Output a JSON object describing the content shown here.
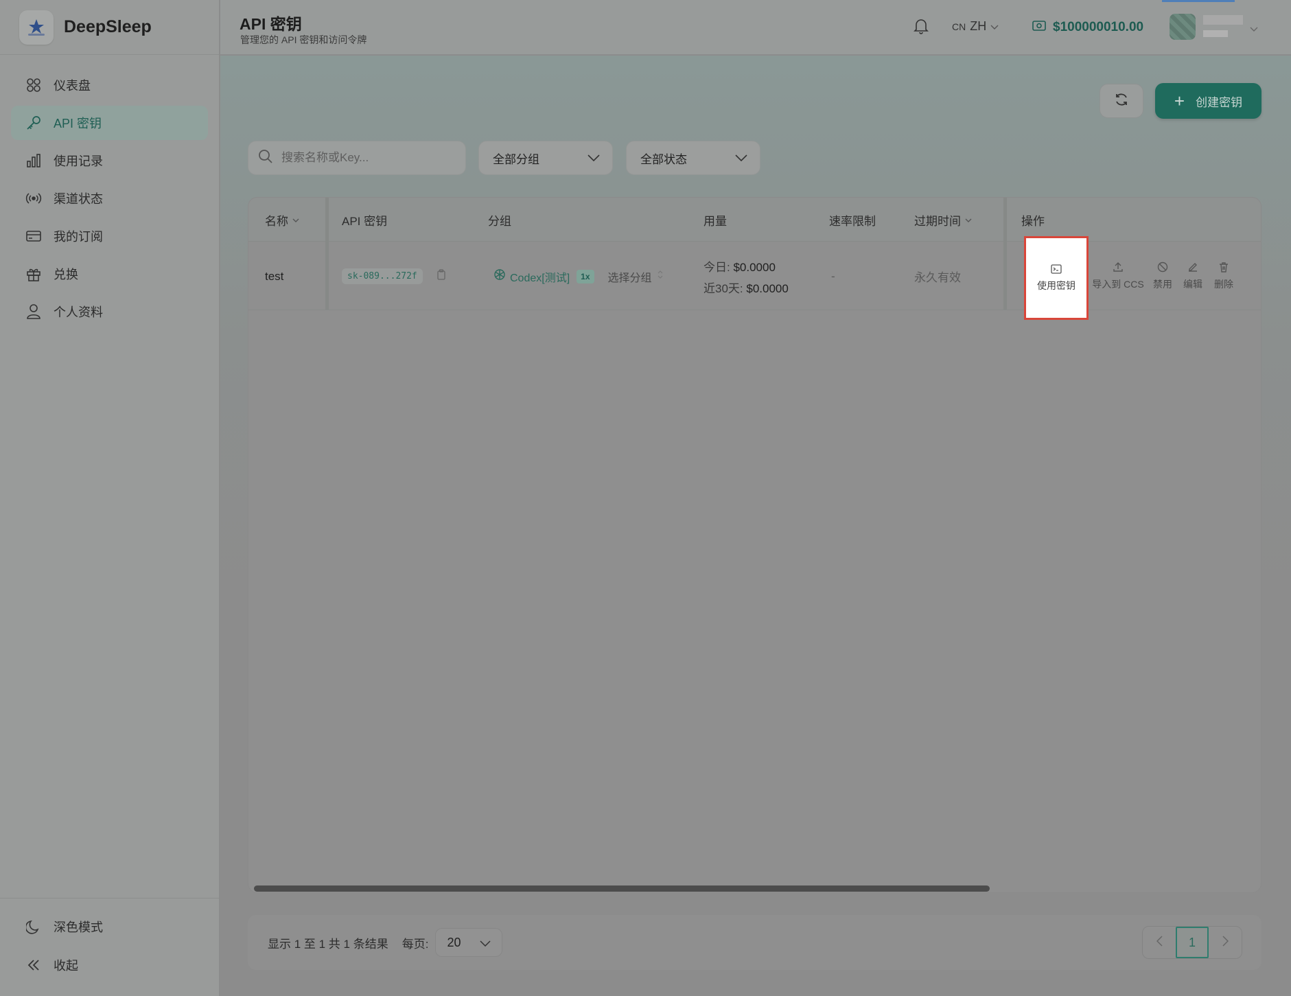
{
  "brand": {
    "name": "DeepSleep"
  },
  "sidebar": {
    "items": [
      {
        "label": "仪表盘",
        "icon": "dashboard-grid-icon"
      },
      {
        "label": "API 密钥",
        "icon": "key-icon",
        "active": true
      },
      {
        "label": "使用记录",
        "icon": "bar-chart-icon"
      },
      {
        "label": "渠道状态",
        "icon": "broadcast-icon"
      },
      {
        "label": "我的订阅",
        "icon": "credit-card-icon"
      },
      {
        "label": "兑换",
        "icon": "gift-icon"
      },
      {
        "label": "个人资料",
        "icon": "user-icon"
      }
    ],
    "bottom": [
      {
        "label": "深色模式",
        "icon": "moon-icon"
      },
      {
        "label": "收起",
        "icon": "double-chevron-left-icon"
      }
    ]
  },
  "header": {
    "title": "API 密钥",
    "subtitle": "管理您的 API 密钥和访问令牌",
    "lang_prefix": "CN",
    "lang": "ZH",
    "balance": "$100000010.00"
  },
  "toolbar": {
    "create_label": "创建密钥"
  },
  "filters": {
    "search_placeholder": "搜索名称或Key...",
    "group_select": "全部分组",
    "status_select": "全部状态"
  },
  "table": {
    "headers": {
      "name": "名称",
      "key": "API 密钥",
      "group": "分组",
      "usage": "用量",
      "rate_limit": "速率限制",
      "expires": "过期时间",
      "actions": "操作"
    },
    "rows": [
      {
        "name": "test",
        "key": "sk-089...272f",
        "group": "Codex[测试]",
        "multiplier": "1x",
        "pick_group": "选择分组",
        "usage_today_label": "今日:",
        "usage_today": "$0.0000",
        "usage_30d_label": "近30天:",
        "usage_30d": "$0.0000",
        "rate_limit": "-",
        "expires": "永久有效",
        "actions": {
          "use": "使用密钥",
          "import": "导入到 CCS",
          "disable": "禁用",
          "edit": "编辑",
          "delete": "删除"
        }
      }
    ]
  },
  "pagination": {
    "summary": "显示 1 至 1 共 1 条结果",
    "per_page_label": "每页:",
    "per_page": "20",
    "current_page": "1"
  },
  "colors": {
    "accent": "#1f6b5d",
    "highlight_border": "#d9463a",
    "balance": "#1d5b51"
  }
}
